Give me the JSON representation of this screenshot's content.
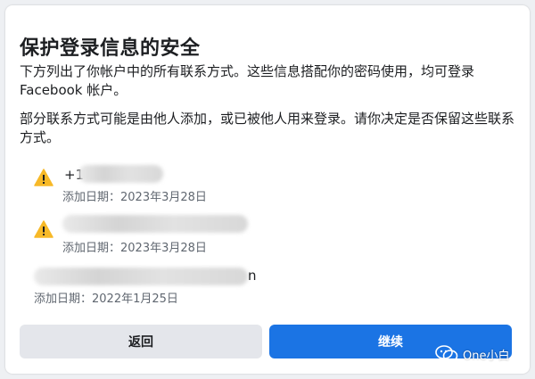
{
  "dialog": {
    "title": "保护登录信息的安全",
    "description_1": "下方列出了你帐户中的所有联系方式。这些信息搭配你的密码使用，均可登录 Facebook 帐户。",
    "description_2": "部分联系方式可能是由他人添加，或已被他人用来登录。请你决定是否保留这些联系方式。"
  },
  "contacts": [
    {
      "value": "+1",
      "added": "添加日期：2023年3月28日",
      "icon": "warning-icon",
      "warning": true
    },
    {
      "value": "",
      "added": "添加日期：2023年3月28日",
      "icon": "warning-icon",
      "warning": true
    },
    {
      "value": "n",
      "added": "添加日期：2022年1月25日",
      "warning": false
    }
  ],
  "buttons": {
    "back_label": "返回",
    "continue_label": "继续"
  },
  "watermark": {
    "text": "One小白",
    "icon": "wechat-icon"
  },
  "colors": {
    "primary": "#1b74e4",
    "secondary_button": "#e4e6eb",
    "warning": "#f7b928"
  }
}
